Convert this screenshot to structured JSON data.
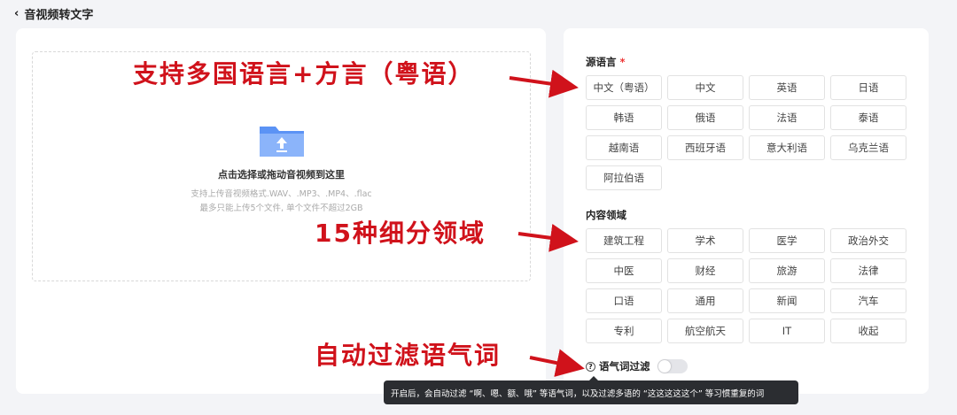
{
  "header": {
    "title": "音视频转文字"
  },
  "upload": {
    "title": "点击选择或拖动音视频到这里",
    "formats": "支持上传音视频格式.WAV、.MP3、.MP4、.flac",
    "limit": "最多只能上传5个文件, 单个文件不超过2GB"
  },
  "source_lang": {
    "label": "源语言",
    "required": "*",
    "options": [
      "中文（粤语）",
      "中文",
      "英语",
      "日语",
      "韩语",
      "俄语",
      "法语",
      "泰语",
      "越南语",
      "西班牙语",
      "意大利语",
      "乌克兰语",
      "阿拉伯语"
    ]
  },
  "domain": {
    "label": "内容领域",
    "options": [
      "建筑工程",
      "学术",
      "医学",
      "政治外交",
      "中医",
      "财经",
      "旅游",
      "法律",
      "口语",
      "通用",
      "新闻",
      "汽车",
      "专利",
      "航空航天",
      "IT",
      "收起"
    ]
  },
  "filter": {
    "label": "语气词过滤",
    "enabled": false,
    "tooltip": "开启后，会自动过滤 “啊、嗯、额、哦” 等语气词，以及过滤多语的 “这这这这这个” 等习惯重复的词"
  },
  "annotations": [
    "支持多国语言+方言（粤语）",
    "15种细分领域",
    "自动过滤语气词"
  ],
  "colors": {
    "annotation": "#d0121b",
    "folder": "#3b7cf0"
  }
}
